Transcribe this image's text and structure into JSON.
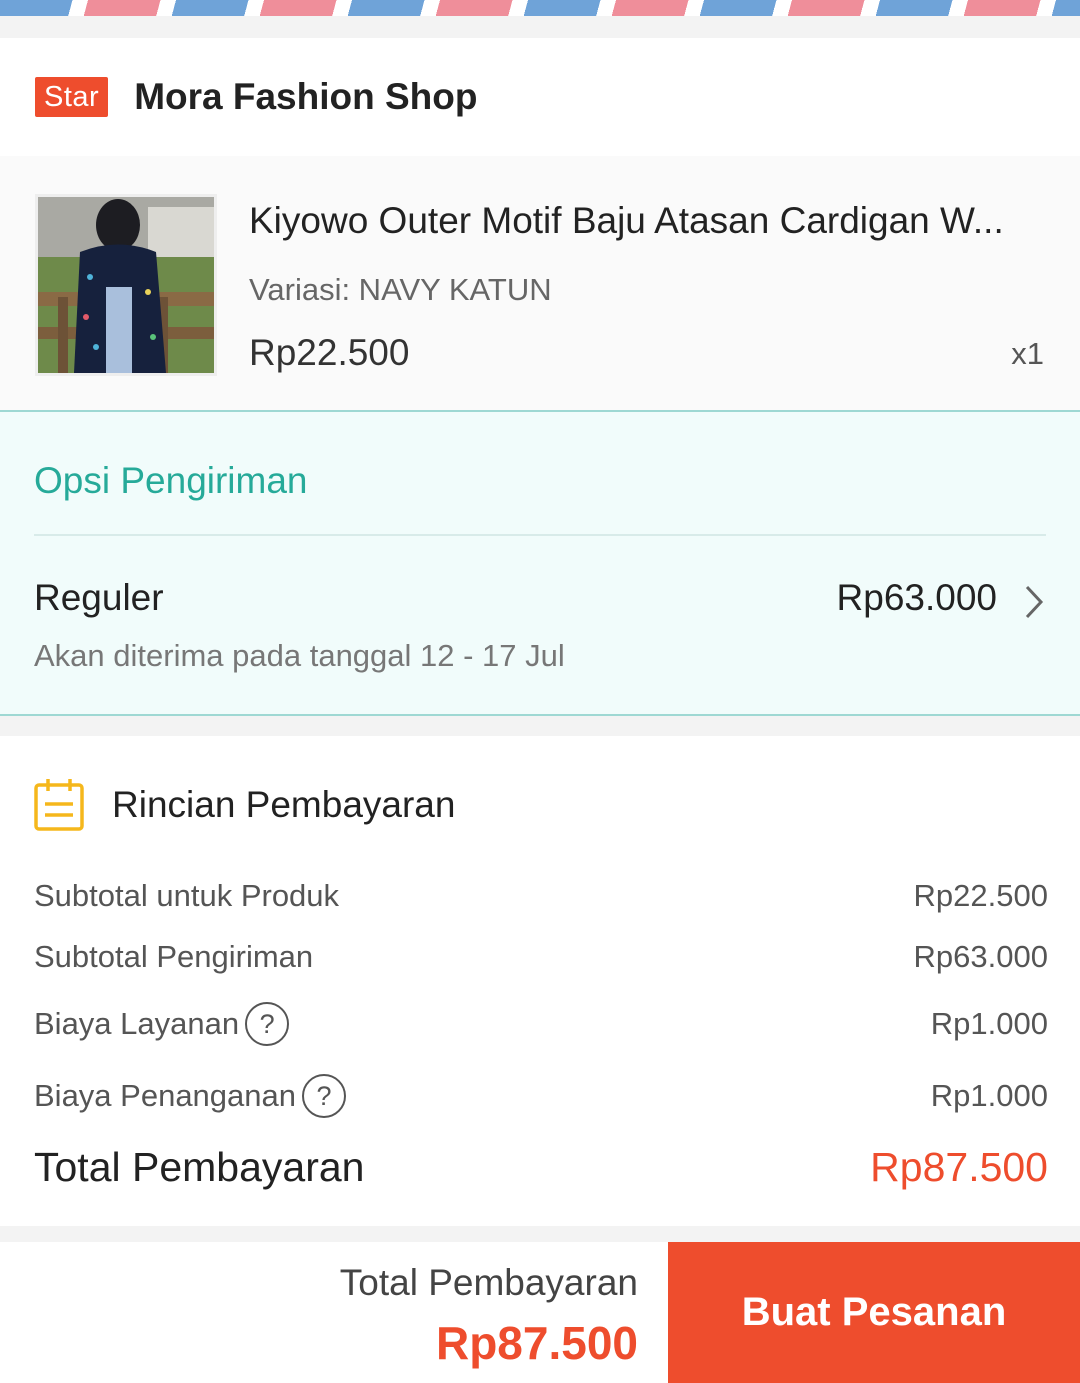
{
  "shop": {
    "badge": "Star",
    "name": "Mora Fashion Shop"
  },
  "product": {
    "title": "Kiyowo Outer Motif Baju Atasan Cardigan W...",
    "variant": "Variasi: NAVY KATUN",
    "price": "Rp22.500",
    "qty": "x1"
  },
  "shipping": {
    "title": "Opsi Pengiriman",
    "option": "Reguler",
    "price": "Rp63.000",
    "eta": "Akan diterima pada tanggal 12 - 17 Jul"
  },
  "payment": {
    "title": "Rincian Pembayaran",
    "rows": [
      {
        "label": "Subtotal untuk Produk",
        "value": "Rp22.500"
      },
      {
        "label": "Subtotal Pengiriman",
        "value": "Rp63.000"
      },
      {
        "label": "Biaya Layanan",
        "value": "Rp1.000"
      },
      {
        "label": "Biaya Penanganan",
        "value": "Rp1.000"
      }
    ],
    "total_label": "Total Pembayaran",
    "total_value": "Rp87.500",
    "help_symbol": "?"
  },
  "bottom": {
    "total_label": "Total Pembayaran",
    "total_value": "Rp87.500",
    "button_label": "Buat Pesanan"
  },
  "colors": {
    "accent": "#ee4d2d",
    "teal": "#26aa99",
    "calendar": "#f5b71b"
  }
}
